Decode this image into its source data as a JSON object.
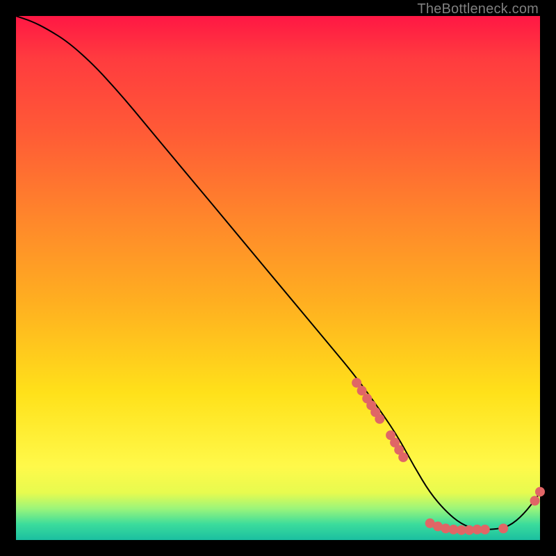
{
  "watermark": "TheBottleneck.com",
  "colors": {
    "background": "#000000",
    "curve": "#000000",
    "dot": "#e06666",
    "gradient_top": "#ff1744",
    "gradient_bottom": "#1bbfa0"
  },
  "chart_data": {
    "type": "line",
    "title": "",
    "xlabel": "",
    "ylabel": "",
    "xlim": [
      0,
      100
    ],
    "ylim": [
      0,
      100
    ],
    "grid": false,
    "legend": false,
    "note": "Axes have no tick labels in the source image; x/y scaled 0–100 by position.",
    "series": [
      {
        "name": "bottleneck-curve",
        "x": [
          0,
          3,
          6,
          10,
          15,
          20,
          25,
          30,
          35,
          40,
          45,
          50,
          55,
          60,
          65,
          70,
          73,
          76,
          79,
          82,
          85,
          88,
          91,
          94,
          97,
          100
        ],
        "y": [
          100,
          99,
          97.5,
          95,
          90.5,
          85,
          79,
          73,
          67,
          61,
          55,
          49,
          43,
          37,
          31,
          24,
          19.5,
          14,
          9,
          5.5,
          3,
          2,
          2,
          2.5,
          5,
          9
        ]
      }
    ],
    "scatter_clusters": [
      {
        "name": "descending-cluster",
        "points": [
          {
            "x": 65,
            "y": 30
          },
          {
            "x": 66,
            "y": 28.5
          },
          {
            "x": 67,
            "y": 27
          },
          {
            "x": 67.8,
            "y": 25.7
          },
          {
            "x": 68.6,
            "y": 24.4
          },
          {
            "x": 69.4,
            "y": 23.1
          },
          {
            "x": 71.5,
            "y": 20
          },
          {
            "x": 72.3,
            "y": 18.6
          },
          {
            "x": 73.1,
            "y": 17.2
          },
          {
            "x": 73.9,
            "y": 15.8
          }
        ]
      },
      {
        "name": "floor-cluster",
        "points": [
          {
            "x": 79,
            "y": 3.2
          },
          {
            "x": 80.5,
            "y": 2.6
          },
          {
            "x": 82,
            "y": 2.2
          },
          {
            "x": 83.5,
            "y": 2.0
          },
          {
            "x": 85,
            "y": 1.9
          },
          {
            "x": 86.5,
            "y": 1.9
          },
          {
            "x": 88,
            "y": 2.0
          },
          {
            "x": 89.5,
            "y": 2.0
          },
          {
            "x": 93,
            "y": 2.2
          }
        ]
      },
      {
        "name": "tail-cluster",
        "points": [
          {
            "x": 99,
            "y": 7.5
          },
          {
            "x": 100,
            "y": 9.2
          }
        ]
      }
    ]
  }
}
